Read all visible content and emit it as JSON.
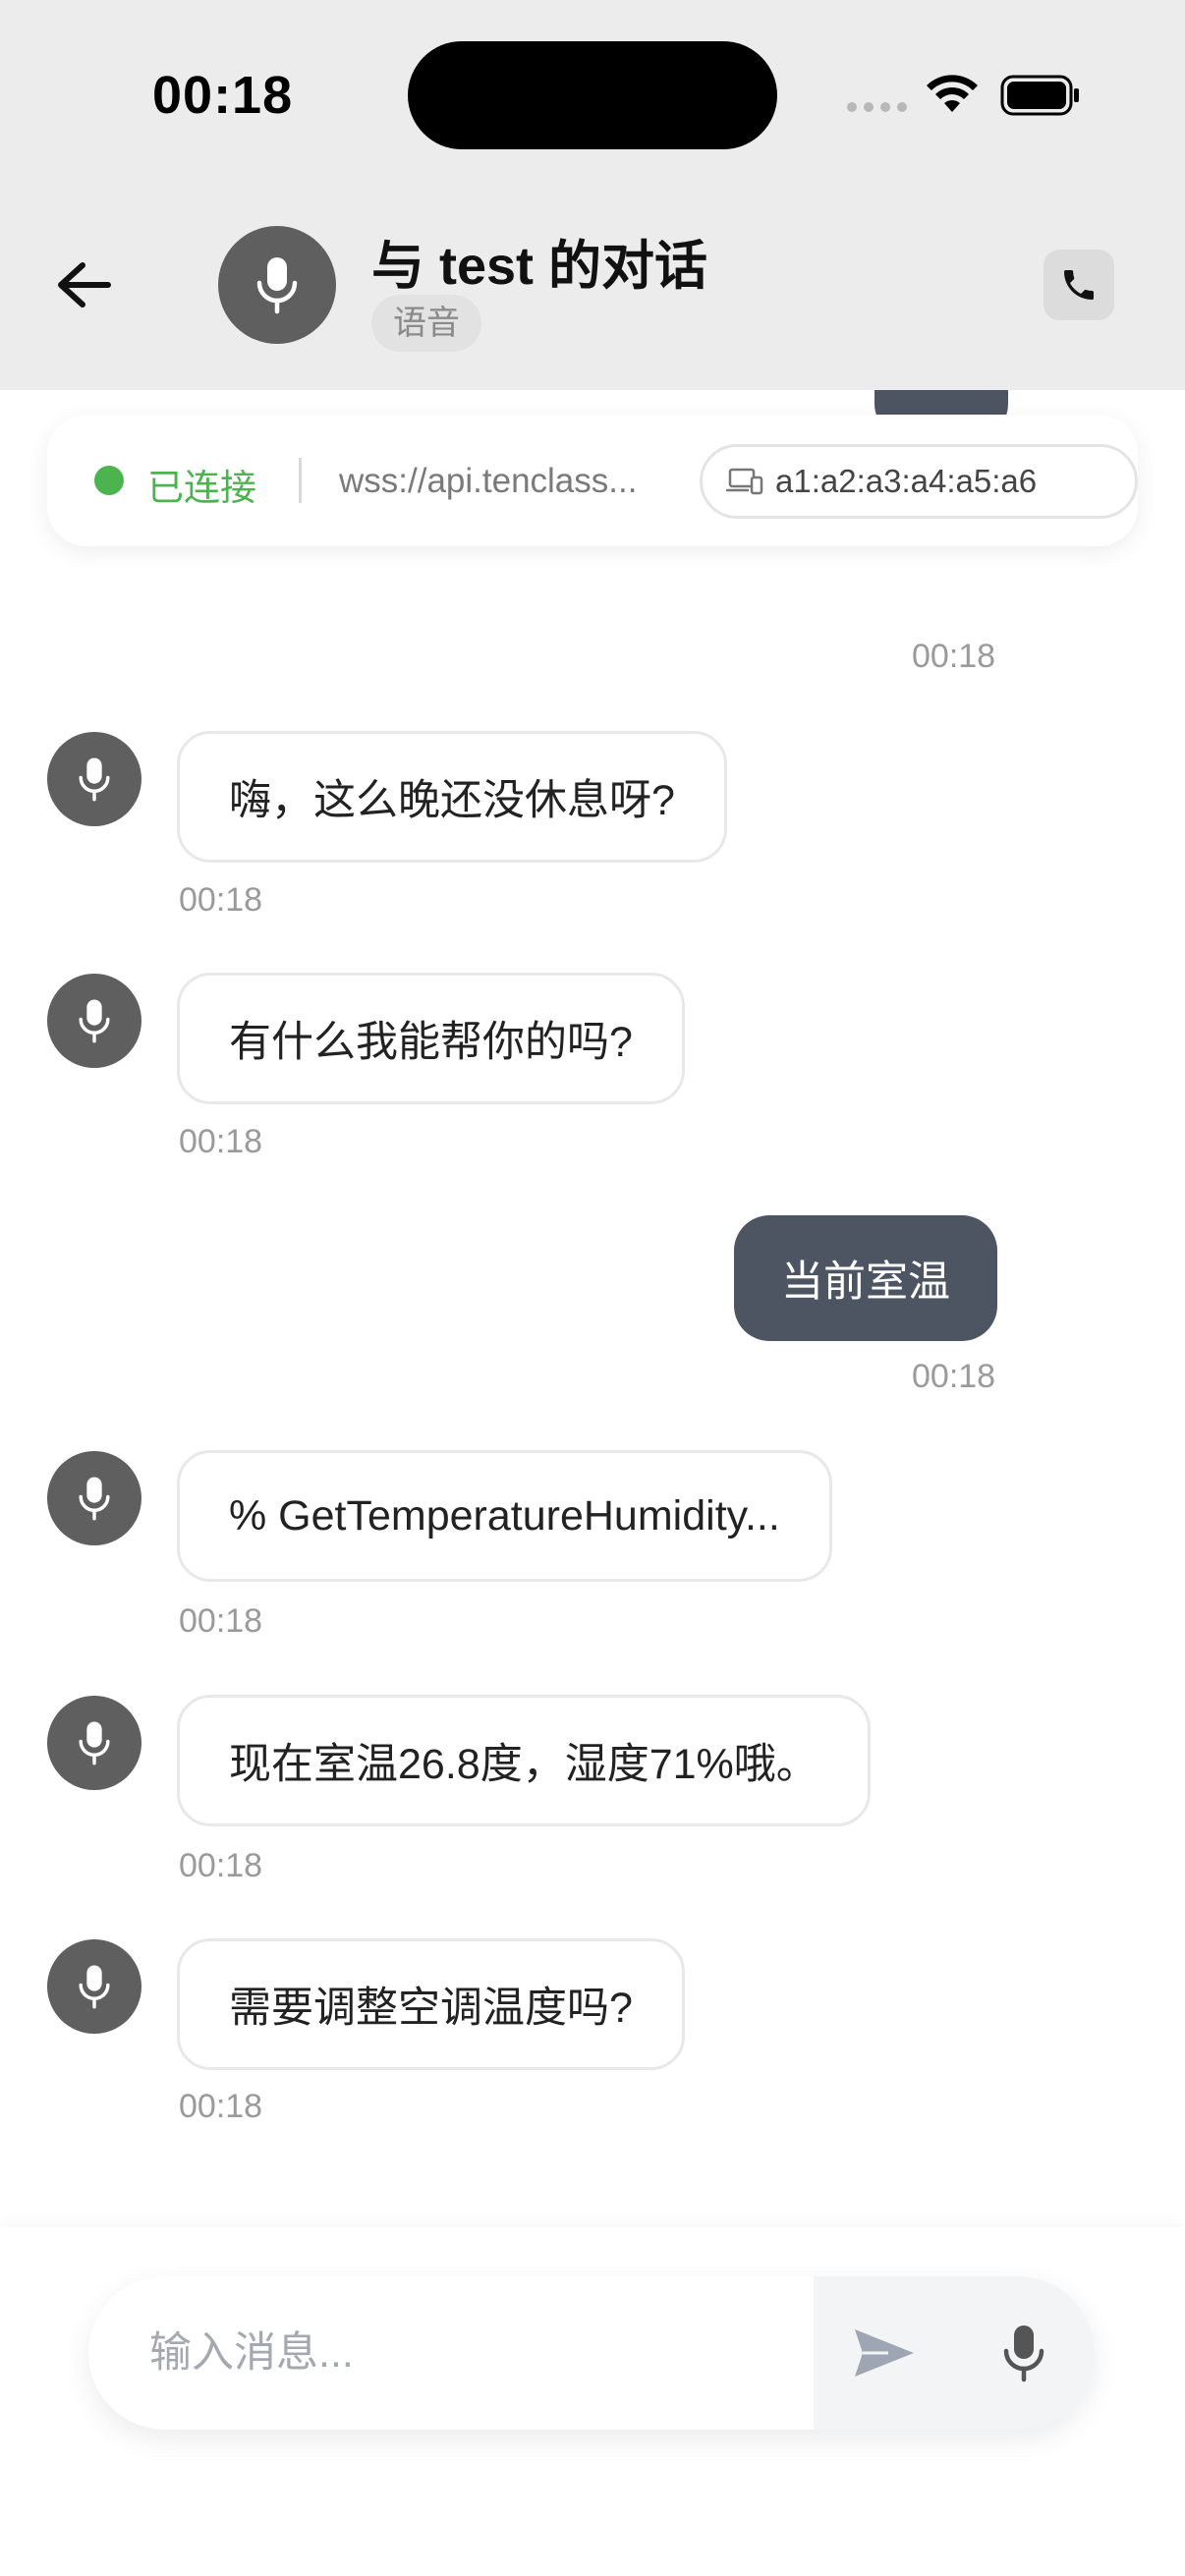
{
  "status_bar": {
    "time": "00:18"
  },
  "header": {
    "title": "与 test 的对话",
    "badge": "语音"
  },
  "connection": {
    "status": "已连接",
    "url": "wss://api.tenclass...",
    "device_mac": "a1:a2:a3:a4:a5:a6",
    "status_color": "#4cb34f"
  },
  "messages": [
    {
      "role": "user",
      "text": "",
      "time": "00:18"
    },
    {
      "role": "bot",
      "text": "嗨，这么晚还没休息呀?",
      "time": "00:18"
    },
    {
      "role": "bot",
      "text": "有什么我能帮你的吗?",
      "time": "00:18"
    },
    {
      "role": "user",
      "text": "当前室温",
      "time": "00:18"
    },
    {
      "role": "bot",
      "text": "% GetTemperatureHumidity...",
      "time": "00:18"
    },
    {
      "role": "bot",
      "text": "现在室温26.8度，湿度71%哦。",
      "time": "00:18"
    },
    {
      "role": "bot",
      "text": "需要调整空调温度吗?",
      "time": "00:18"
    }
  ],
  "composer": {
    "placeholder": "输入消息..."
  },
  "icons": {
    "back": "arrow-left-icon",
    "avatar": "microphone-icon",
    "call": "phone-icon",
    "device": "devices-icon",
    "send": "send-icon",
    "mic": "microphone-icon"
  },
  "colors": {
    "user_bubble": "#4d5563",
    "avatar": "#5f5f5f",
    "header_bg": "#ececec"
  }
}
